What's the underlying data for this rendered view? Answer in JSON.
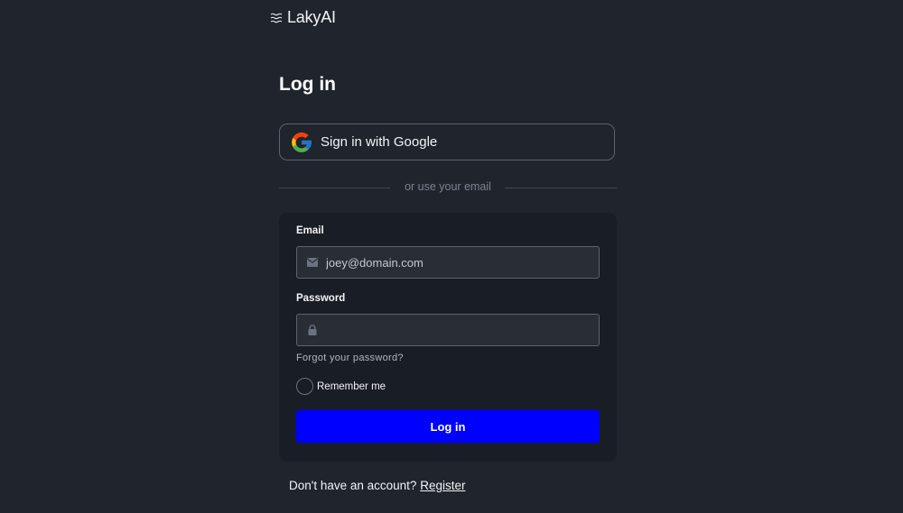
{
  "brand": {
    "name": "LakyAI",
    "icon": "waves-icon"
  },
  "page": {
    "title": "Log in"
  },
  "google": {
    "label": "Sign in with Google",
    "icon": "google-logo-icon"
  },
  "divider": {
    "text": "or use your email"
  },
  "form": {
    "email_label": "Email",
    "email_placeholder": "joey@domain.com",
    "email_value": "",
    "email_icon": "envelope-icon",
    "password_label": "Password",
    "password_value": "",
    "password_icon": "lock-icon",
    "forgot_label": "Forgot your password?",
    "remember_label": "Remember me",
    "remember_checked": false,
    "submit_label": "Log in"
  },
  "footer": {
    "prompt": "Don't have an account?",
    "register_label": "Register"
  },
  "colors": {
    "background": "#1f242d",
    "card": "#191d25",
    "primary": "#0000ff"
  }
}
